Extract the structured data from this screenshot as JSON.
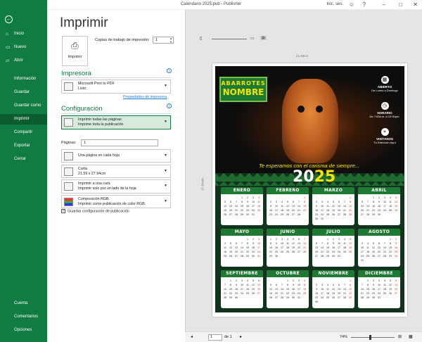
{
  "window": {
    "title": "Calendario 2025.pub  -  Publisher",
    "user": "Inic. ses."
  },
  "sidebar": {
    "items": [
      {
        "label": "Inicio",
        "icon": "home-icon"
      },
      {
        "label": "Nuevo",
        "icon": "new-doc-icon"
      },
      {
        "label": "Abrir",
        "icon": "folder-icon"
      },
      {
        "label": "Información"
      },
      {
        "label": "Guardar"
      },
      {
        "label": "Guardar como"
      },
      {
        "label": "Imprimir"
      },
      {
        "label": "Compartir"
      },
      {
        "label": "Exportar"
      },
      {
        "label": "Cerrar"
      }
    ],
    "footer": [
      {
        "label": "Cuenta"
      },
      {
        "label": "Comentarios"
      },
      {
        "label": "Opciones"
      }
    ],
    "active_color": "#0b5d30"
  },
  "print": {
    "title": "Imprimir",
    "button": "Imprimir",
    "copies_label": "Copias de trabajo de impresión:",
    "copies_value": "1",
    "printer_heading": "Impresora",
    "printer_name": "Microsoft Print to PDF",
    "printer_status": "Listo",
    "printer_props": "Propiedades de impresora",
    "config_heading": "Configuración",
    "pages_label": "Páginas:",
    "pages_value": "1",
    "save_config": "Guardar configuración de publicación",
    "dropdowns": [
      {
        "line1": "Imprimir todas las páginas",
        "line2": "Imprime toda la publicación"
      },
      {
        "line1": "Una página en cada hoja",
        "line2": ""
      },
      {
        "line1": "Carta",
        "line2": "21.59 x 27.94cm"
      },
      {
        "line1": "Imprimir a una cara",
        "line2": "Imprimir solo por un lado de la hoja"
      },
      {
        "line1": "Composición RGB",
        "line2": "Imprimir como publicación de color RGB."
      }
    ]
  },
  "preview": {
    "ruler_h": "21.59cm",
    "ruler_v": "27.94cm",
    "page_current": "1",
    "page_of": "de 1",
    "zoom": "74%",
    "poster": {
      "logo_line1": "ABARROTES",
      "logo_line2": "NOMBRE",
      "info": [
        {
          "title": "ABIERTO",
          "text": "De Lunes a Domingo",
          "icon": "calendar-icon"
        },
        {
          "title": "HORARIO",
          "text": "De 7:00a.m. a 10:30pm.",
          "icon": "clock-icon"
        },
        {
          "title": "VISÍTANOS",
          "text": "Tu Dirección Aquí",
          "icon": "location-icon"
        }
      ],
      "slogan": "Te esperamos con el carisma de siempre...",
      "year_a": "20",
      "year_b": "25",
      "accent": "#f2e400",
      "green": "#1e7a32",
      "months": [
        "ENERO",
        "FEBRERO",
        "MARZO",
        "ABRIL",
        "MAYO",
        "JUNIO",
        "JULIO",
        "AGOSTO",
        "SEPTIEMBRE",
        "OCTUBRE",
        "NOVIEMBRE",
        "DICIEMBRE"
      ]
    }
  }
}
